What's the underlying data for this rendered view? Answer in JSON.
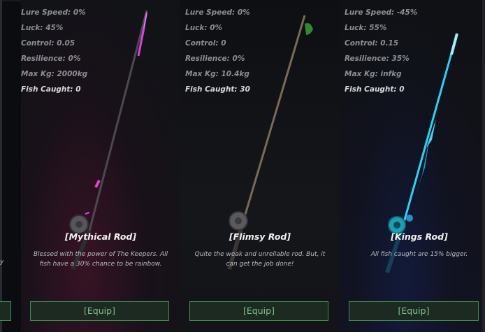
{
  "cards": [
    {
      "stats": {
        "lure_speed": "Lure Speed: 0%",
        "luck": "Luck: 45%",
        "control": "Control: 0.05",
        "resilience": "Resilience: 0%",
        "max_kg": "Max Kg: 2000kg",
        "fish_caught": "Fish Caught: 0"
      },
      "name": "[Mythical Rod]",
      "description": "Blessed with the power of The Keepers. All fish have a 30% chance to be rainbow.",
      "equip_label": "[Equip]",
      "accent_color": "#e040e0"
    },
    {
      "stats": {
        "lure_speed": "Lure Speed: 0%",
        "luck": "Luck: 0%",
        "control": "Control: 0",
        "resilience": "Resilience: 0%",
        "max_kg": "Max Kg: 10.4kg",
        "fish_caught": "Fish Caught: 30"
      },
      "name": "[Flimsy Rod]",
      "description": "Quite the weak and unreliable rod. But, it can get the job done!",
      "equip_label": "[Equip]",
      "accent_color": "#3ea33e"
    },
    {
      "stats": {
        "lure_speed": "Lure Speed: -45%",
        "luck": "Luck: 55%",
        "control": "Control: 0.15",
        "resilience": "Resilience: 35%",
        "max_kg": "Max Kg: infkg",
        "fish_caught": "Fish Caught: 0"
      },
      "name": "[Kings Rod]",
      "description": "All fish caught are 15% bigger.",
      "equip_label": "[Equip]",
      "accent_color": "#35d3f2"
    }
  ],
  "partial_left_text": "y"
}
